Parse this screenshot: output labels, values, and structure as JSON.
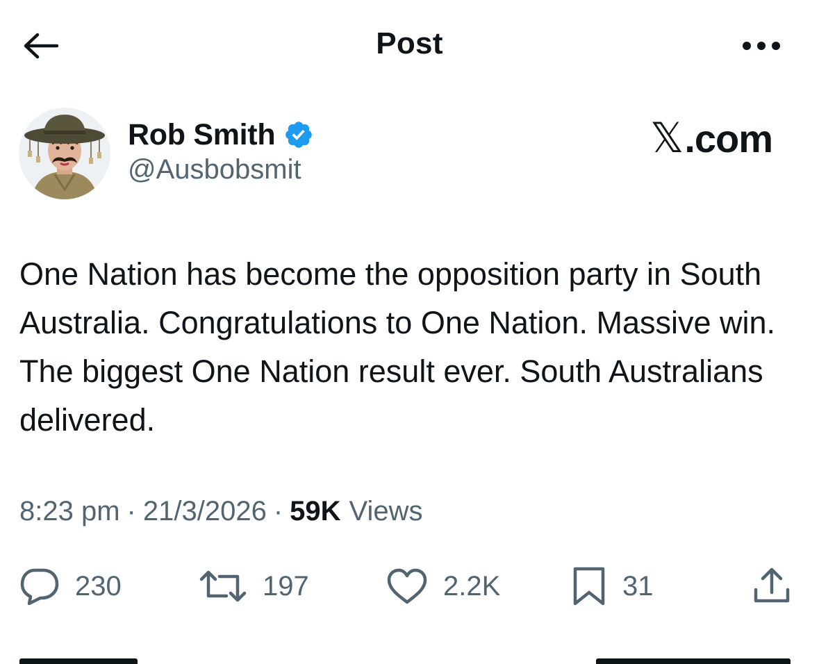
{
  "header": {
    "title": "Post",
    "back_icon": "arrow-left-icon",
    "more_icon": "more-horizontal-icon"
  },
  "author": {
    "display_name": "Rob Smith",
    "handle": "@Ausbobsmit",
    "verified": true,
    "verified_color": "#1d9bf0",
    "avatar_icon": "avatar-icon"
  },
  "watermark": {
    "x_glyph": "𝕏",
    "suffix": ".com"
  },
  "post": {
    "text": "One Nation has become the opposition party in South Australia. Congratulations to One Nation. Massive win. The biggest One Nation result ever. South Australians delivered."
  },
  "meta": {
    "time": "8:23 pm",
    "separator": "·",
    "date": "21/3/2026",
    "views_count": "59K",
    "views_label": "Views"
  },
  "actions": {
    "replies": {
      "icon": "reply-icon",
      "count": "230"
    },
    "reposts": {
      "icon": "repost-icon",
      "count": "197"
    },
    "likes": {
      "icon": "heart-icon",
      "count": "2.2K"
    },
    "bookmarks": {
      "icon": "bookmark-icon",
      "count": "31"
    },
    "share": {
      "icon": "share-icon"
    }
  },
  "colors": {
    "text_primary": "#0f1419",
    "text_secondary": "#536471",
    "accent": "#1d9bf0",
    "background": "#ffffff"
  }
}
